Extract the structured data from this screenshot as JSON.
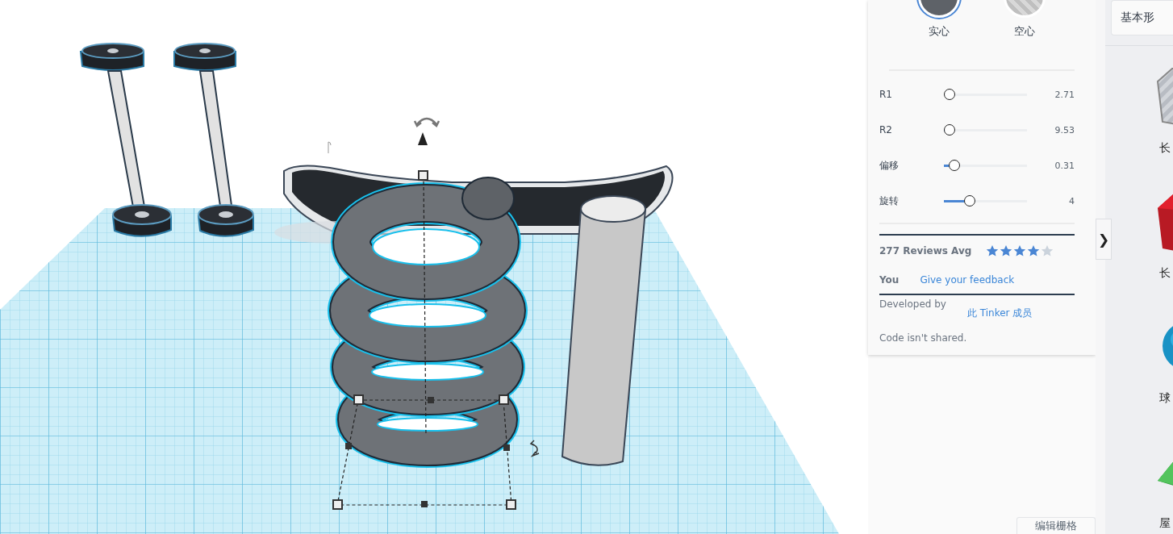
{
  "shape_options": [
    {
      "label": "实心",
      "kind": "solid",
      "selected": true
    },
    {
      "label": "空心",
      "kind": "hole",
      "selected": false
    }
  ],
  "parameters": [
    {
      "label": "R1",
      "level": 0,
      "reading": "2.71"
    },
    {
      "label": "R2",
      "level": 0.07,
      "reading": "9.53"
    },
    {
      "label": "偏移",
      "level": 0.13,
      "reading": "0.31"
    },
    {
      "label": "旋转",
      "level": 0.31,
      "reading": "4"
    }
  ],
  "reviews": {
    "summary": "277 Reviews Avg",
    "stars": 4
  },
  "feedback": {
    "label": "You",
    "link": "Give your feedback"
  },
  "developer": {
    "label": "Developed by",
    "link": "此 Tinker 成员"
  },
  "code_note": "Code isn't shared.",
  "panel_toggle": "❯",
  "edit_grid_button": "编辑栅格",
  "library": {
    "title": "基本形",
    "items": [
      {
        "label": "长",
        "kind": "box-hole"
      },
      {
        "label": "长",
        "kind": "box"
      },
      {
        "label": "球",
        "kind": "sphere"
      },
      {
        "label": "屋",
        "kind": "roof"
      }
    ]
  }
}
